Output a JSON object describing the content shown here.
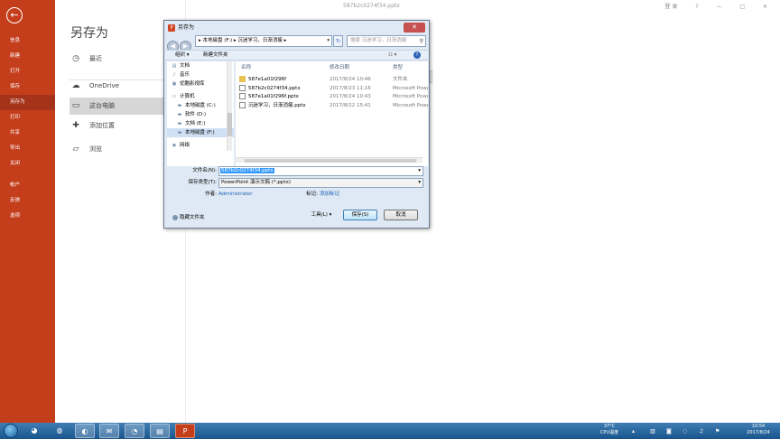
{
  "window": {
    "title": "587b2c0274f34.pptx",
    "signin": "登录",
    "help": "?",
    "minimize": "—",
    "maximize": "□",
    "close": "✕"
  },
  "backstage": {
    "nav": [
      "信息",
      "新建",
      "打开",
      "保存",
      "另存为",
      "打印",
      "共享",
      "导出",
      "关闭"
    ],
    "nav_active": "另存为",
    "nav_bottom": [
      "帐户",
      "反馈",
      "选项"
    ],
    "page_title": "另存为",
    "locations": [
      {
        "label": "最近",
        "icon": "◷"
      },
      {
        "label": "OneDrive",
        "icon": "☁"
      },
      {
        "label": "这台电脑",
        "icon": "▭"
      },
      {
        "label": "添加位置",
        "icon": "✚"
      },
      {
        "label": "浏览",
        "icon": "▱"
      }
    ]
  },
  "dialog": {
    "title": "另存为",
    "address": "▸ 本地磁盘 (F:) ▸ 沉迷学习，日渐消瘦 ▸",
    "search_placeholder": "搜索 沉迷学习，日渐消瘦",
    "toolbar": {
      "organize": "组织 ▾",
      "new_folder": "新建文件夹",
      "view": "☷ ▾",
      "help": "?"
    },
    "tree": [
      {
        "label": "文档",
        "icon": "▤"
      },
      {
        "label": "音乐",
        "icon": "♪"
      },
      {
        "label": "优酷影视库",
        "icon": "▣"
      },
      {
        "label": "计算机",
        "icon": "▭"
      },
      {
        "label": "本地磁盘 (C:)",
        "icon": "▬"
      },
      {
        "label": "软件 (D:)",
        "icon": "▬"
      },
      {
        "label": "文档 (E:)",
        "icon": "▬"
      },
      {
        "label": "本地磁盘 (F:)",
        "icon": "▬"
      },
      {
        "label": "网络",
        "icon": "◉"
      }
    ],
    "columns": {
      "name": "名称",
      "date": "修改日期",
      "type": "类型"
    },
    "files": [
      {
        "name": "587e1a01f296f",
        "date": "2017/8/24 10:46",
        "type": "文件夹",
        "kind": "folder"
      },
      {
        "name": "587b2c0274f34.pptx",
        "date": "2017/8/23 11:16",
        "type": "Microsoft PowerP...",
        "kind": "doc"
      },
      {
        "name": "587e1a01f296f.pptx",
        "date": "2017/8/24 10:43",
        "type": "Microsoft PowerP...",
        "kind": "doc"
      },
      {
        "name": "沉迷学习，日渐消瘦.pptx",
        "date": "2017/8/22 15:41",
        "type": "Microsoft PowerP...",
        "kind": "doc"
      }
    ],
    "filename_label": "文件名(N):",
    "filename_value": "587b2c0274f34.pptx",
    "filetype_label": "保存类型(T):",
    "filetype_value": "PowerPoint 演示文稿 (*.pptx)",
    "author_label": "作者:",
    "author_value": "Administrator",
    "tags_label": "标记:",
    "tags_value": "添加标记",
    "tools_label": "工具(L)",
    "save_label": "保存(S)",
    "cancel_label": "取消",
    "hide_folders": "隐藏文件夹"
  },
  "taskbar": {
    "temp": "37°C",
    "temp_label": "CPU温度",
    "time": "10:54",
    "date": "2017/8/24"
  }
}
